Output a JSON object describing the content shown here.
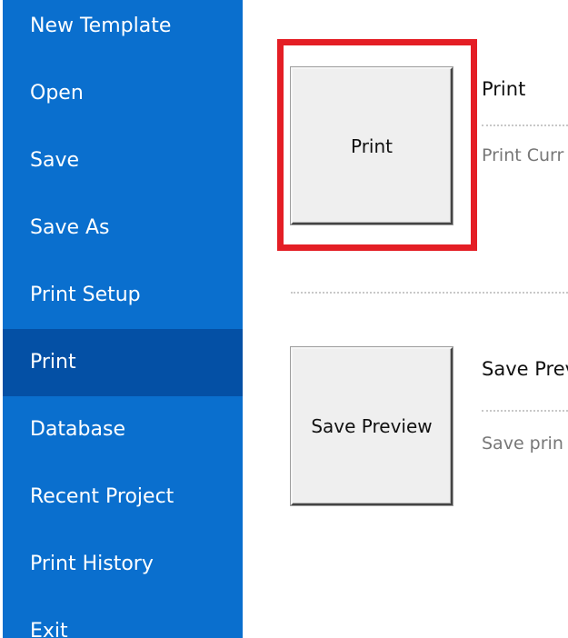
{
  "sidebar": {
    "items": [
      {
        "label": "New Template"
      },
      {
        "label": "Open"
      },
      {
        "label": "Save"
      },
      {
        "label": "Save As"
      },
      {
        "label": "Print Setup"
      },
      {
        "label": "Print"
      },
      {
        "label": "Database"
      },
      {
        "label": "Recent Project"
      },
      {
        "label": "Print History"
      },
      {
        "label": "Exit"
      }
    ],
    "active_item": "Print"
  },
  "main": {
    "print_section": {
      "button_label": "Print",
      "title": "Print",
      "description": "Print Curr"
    },
    "save_preview_section": {
      "button_label": "Save Preview",
      "title": "Save Prev",
      "description": "Save prin"
    }
  },
  "colors": {
    "sidebar_bg": "#0a6fce",
    "sidebar_active_bg": "#0450a5",
    "sidebar_text": "#ffffff",
    "highlight": "#e41e25"
  }
}
